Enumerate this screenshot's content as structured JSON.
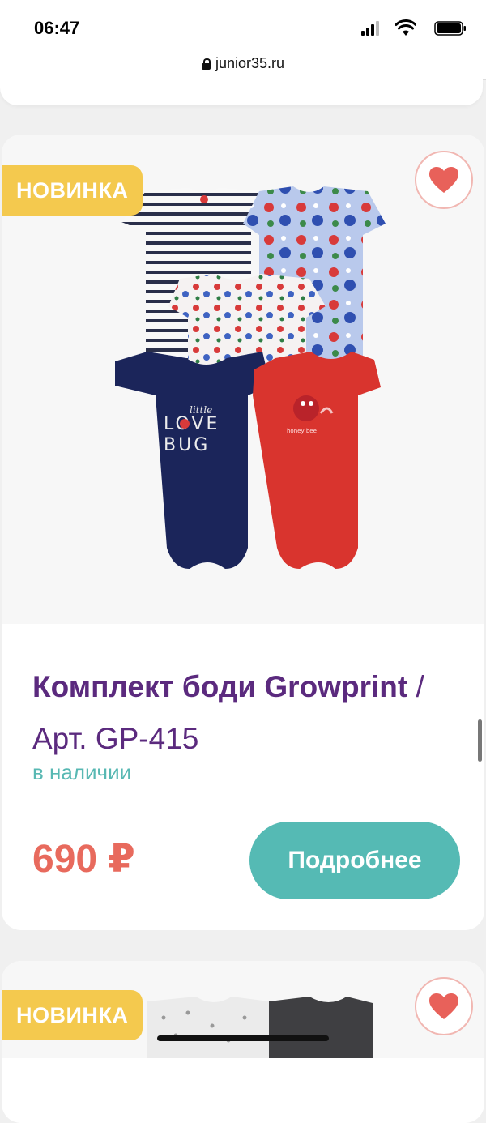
{
  "status_bar": {
    "time": "06:47"
  },
  "browser": {
    "url": "junior35.ru"
  },
  "product": {
    "badge": "НОВИНКА",
    "title_name": "Комплект боди Growprint",
    "title_sep": " /",
    "title_article": "Арт. GP-415",
    "availability": "в наличии",
    "price": "690 ₽",
    "details_button": "Подробнее",
    "bodysuit_prints": {
      "line1": "little",
      "line2": "LOVE",
      "line3": "BUG",
      "line4": "honey bee"
    }
  },
  "next_product": {
    "badge": "НОВИНКА"
  },
  "colors": {
    "accent_purple": "#5b2a7e",
    "badge_yellow": "#f4c94e",
    "teal": "#55bab4",
    "price_red": "#e86a5d",
    "heart": "#e8615a"
  },
  "icons": [
    "lock-icon",
    "heart-icon",
    "signal-icon",
    "wifi-icon",
    "battery-icon"
  ]
}
